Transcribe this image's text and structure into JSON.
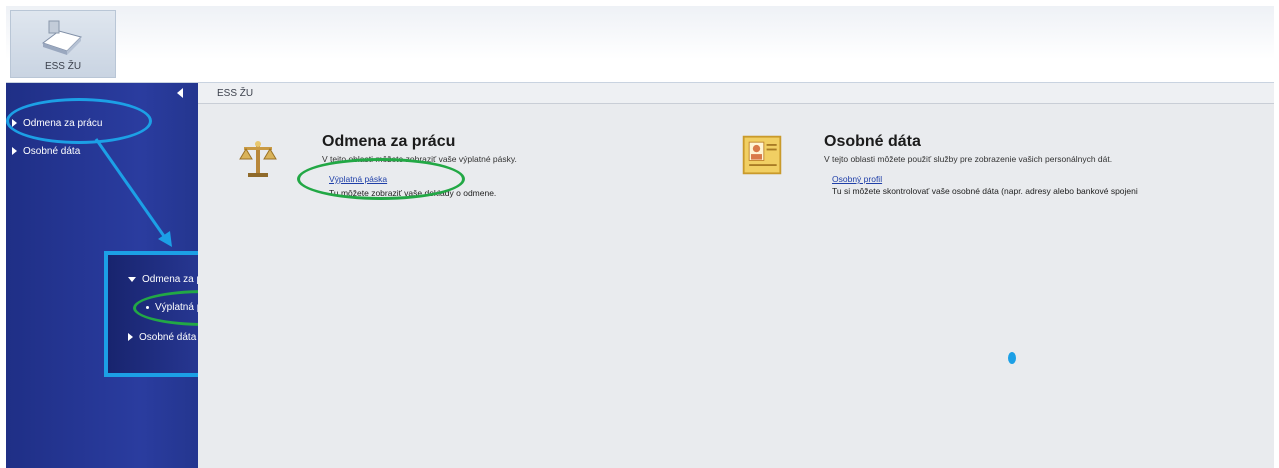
{
  "header": {
    "app_tile_label": "ESS ŽU"
  },
  "sidebar": {
    "items": [
      {
        "label": "Odmena za prácu"
      },
      {
        "label": "Osobné dáta"
      }
    ]
  },
  "callout": {
    "items": [
      {
        "label": "Odmena za prácu"
      },
      {
        "label": "Výplatná páska"
      },
      {
        "label": "Osobné dáta"
      }
    ]
  },
  "breadcrumb": "ESS ŽU",
  "sections": [
    {
      "title": "Odmena za prácu",
      "description": "V tejto oblasti môžete zobraziť vaše výplatné pásky.",
      "link": "Výplatná páska",
      "note": "Tu môžete zobraziť vaše doklady o odmene."
    },
    {
      "title": "Osobné dáta",
      "description": "V tejto oblasti môžete použiť služby pre zobrazenie vašich personálnych dát.",
      "link": "Osobný profil",
      "note": "Tu si môžete skontrolovať vaše osobné dáta (napr. adresy alebo bankové spojeni"
    }
  ],
  "colors": {
    "sidebar": "#2a3c9f",
    "highlight_blue": "#1ca0e6",
    "highlight_green": "#22a845",
    "link": "#1f3fa8"
  },
  "icons": [
    "app-tile-icon",
    "scales-icon",
    "id-card-icon",
    "collapse-arrow-icon"
  ]
}
